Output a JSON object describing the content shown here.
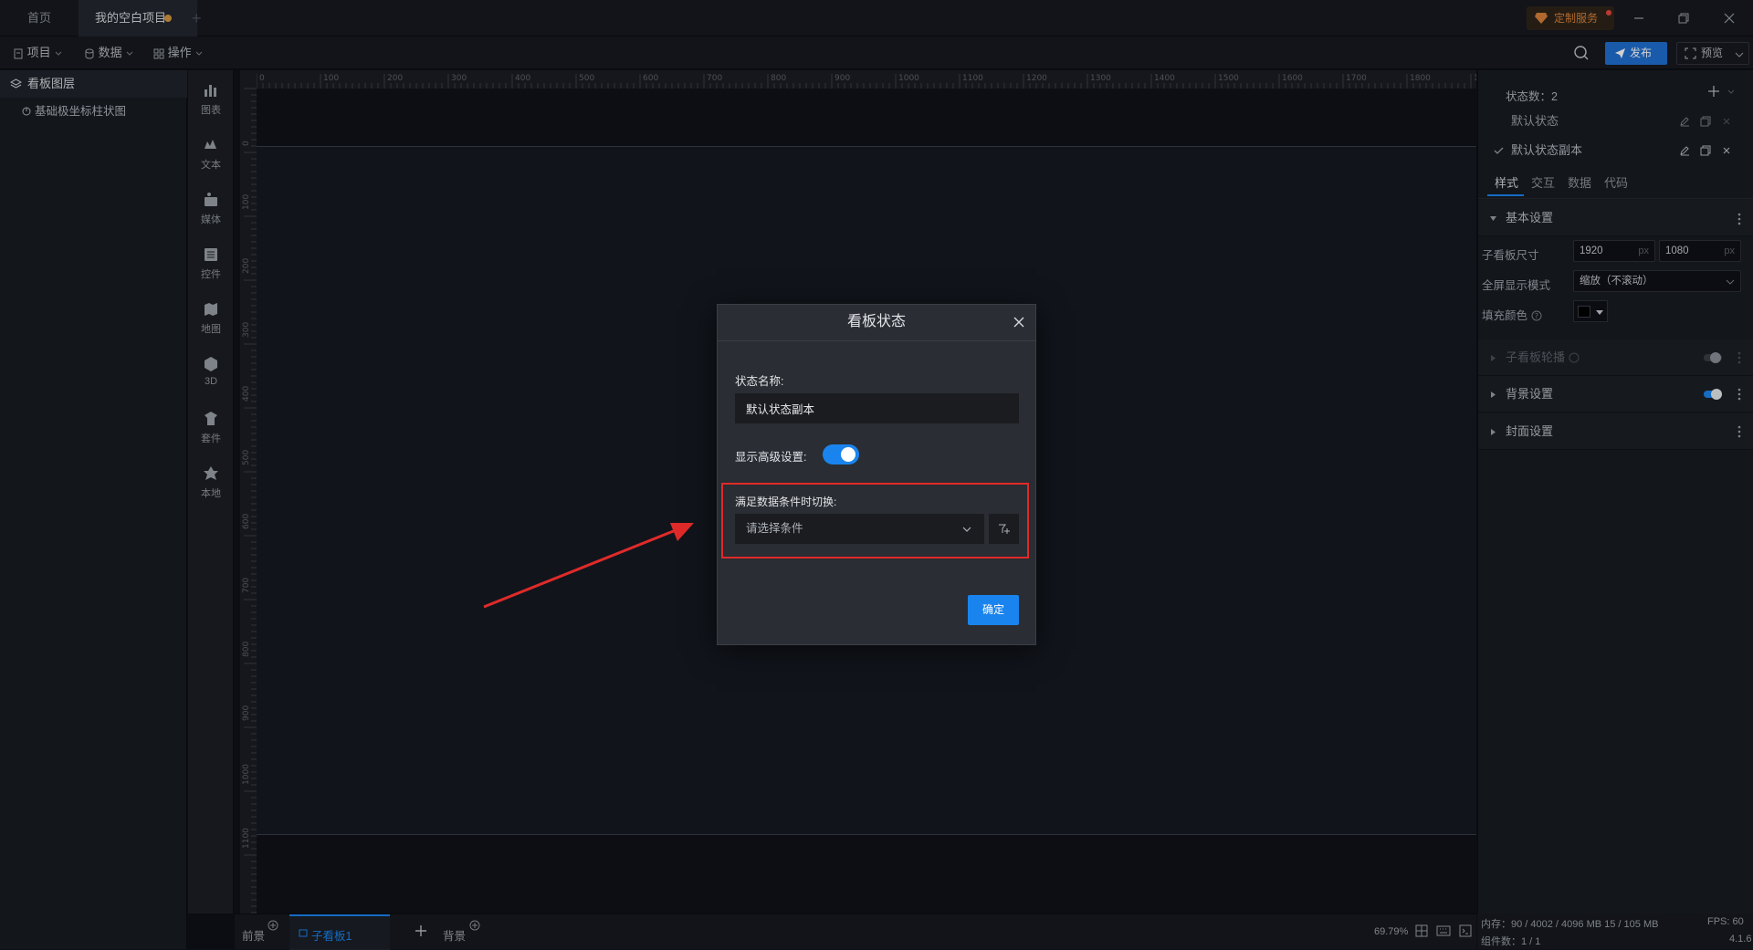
{
  "titlebar": {
    "home_tab": "首页",
    "project_tab": "我的空白项目",
    "custom_service": "定制服务"
  },
  "toolbar": {
    "menu_project": "项目",
    "menu_data": "数据",
    "menu_operation": "操作",
    "publish": "发布",
    "preview": "预览"
  },
  "layers": {
    "header": "看板图层",
    "items": [
      "基础极坐标柱状图"
    ]
  },
  "components": [
    {
      "label": "图表",
      "icon": "chart-icon"
    },
    {
      "label": "文本",
      "icon": "text-icon"
    },
    {
      "label": "媒体",
      "icon": "media-icon"
    },
    {
      "label": "控件",
      "icon": "control-icon"
    },
    {
      "label": "地图",
      "icon": "map-icon"
    },
    {
      "label": "3D",
      "icon": "cube-icon"
    },
    {
      "label": "套件",
      "icon": "kit-icon"
    },
    {
      "label": "本地",
      "icon": "local-icon"
    }
  ],
  "ruler": {
    "h_ticks": [
      "0",
      "100",
      "200",
      "300",
      "400",
      "500",
      "600",
      "700",
      "800",
      "900",
      "1000",
      "1100",
      "1200",
      "1300",
      "1400",
      "1500",
      "1600",
      "1700",
      "1800",
      "1900"
    ],
    "v_ticks": [
      "0",
      "100",
      "200",
      "300",
      "400",
      "500",
      "600",
      "700",
      "800",
      "900",
      "1000",
      "1100"
    ]
  },
  "bottombar": {
    "foreground": "前景",
    "subboard": "子看板1",
    "background": "背景",
    "zoom": "69.79%"
  },
  "rightpanel": {
    "state_count_label": "状态数：2",
    "states": [
      "默认状态",
      "默认状态副本"
    ],
    "tabs": [
      "样式",
      "交互",
      "数据",
      "代码"
    ],
    "basic_settings": "基本设置",
    "size_label": "子看板尺寸",
    "width": "1920",
    "height": "1080",
    "unit": "px",
    "fullscreen_label": "全屏显示模式",
    "fullscreen_value": "缩放（不滚动）",
    "fill_label": "填充颜色",
    "fill_color": "#000000",
    "carousel": "子看板轮播",
    "bg_settings": "背景设置",
    "cover_settings": "封面设置"
  },
  "status": {
    "memory": "内存：90 / 4002 / 4096 MB 15 / 105 MB",
    "fps": "FPS: 60",
    "component_count": "组件数：1 / 1",
    "version": "4.1.6"
  },
  "modal": {
    "title": "看板状态",
    "state_name_label": "状态名称:",
    "state_name_value": "默认状态副本",
    "advanced_label": "显示高级设置:",
    "advanced_on": true,
    "condition_label": "满足数据条件时切换:",
    "condition_placeholder": "请选择条件",
    "confirm": "确定"
  },
  "colors": {
    "accent": "#1a84ee",
    "highlight": "#e02a2a",
    "arrow": "#e02a2a",
    "background": "#0e1117"
  }
}
